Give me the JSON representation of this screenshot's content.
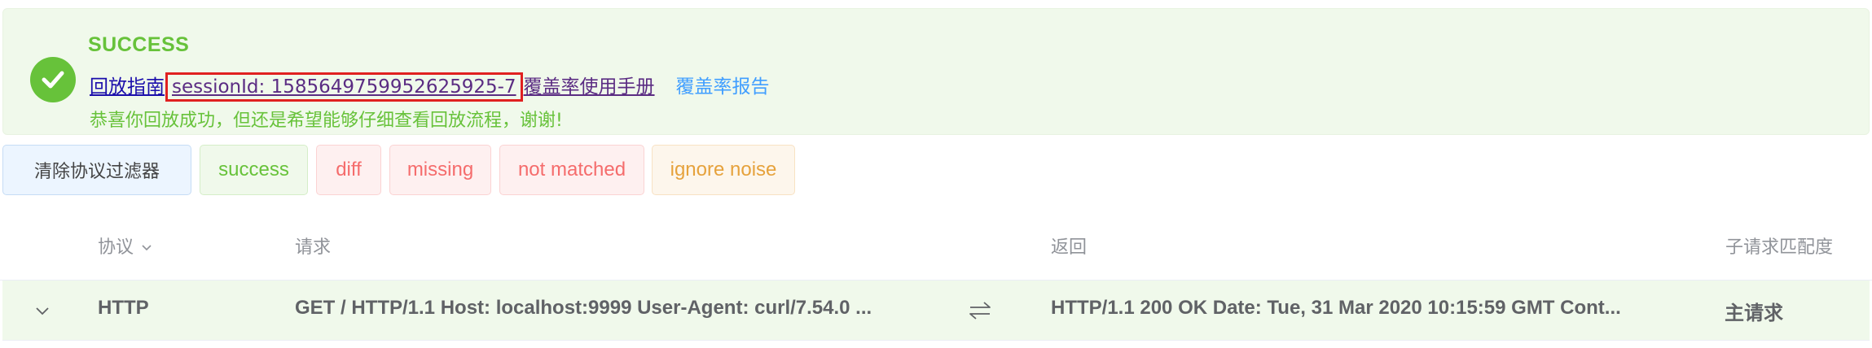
{
  "banner": {
    "title": "SUCCESS",
    "guide_link": "回放指南",
    "session_link": "sessionId: 1585649759952625925-7",
    "manual_link": "覆盖率使用手册",
    "report_link": "覆盖率报告",
    "message": "恭喜你回放成功，但还是希望能够仔细查看回放流程，谢谢!",
    "icon": "check-circle-icon",
    "accent": "#67c23a"
  },
  "filters": {
    "clear": "清除协议过滤器",
    "success": "success",
    "diff": "diff",
    "missing": "missing",
    "not_matched": "not matched",
    "ignore_noise": "ignore noise"
  },
  "table": {
    "headers": {
      "protocol": "协议",
      "request": "请求",
      "response": "返回",
      "match": "子请求匹配度"
    },
    "rows": [
      {
        "protocol": "HTTP",
        "request": "GET / HTTP/1.1 Host: localhost:9999 User-Agent: curl/7.54.0 ...",
        "response": "HTTP/1.1 200 OK Date: Tue, 31 Mar 2020 10:15:59 GMT Cont...",
        "match": "主请求"
      }
    ]
  },
  "colors": {
    "success": "#67c23a",
    "danger": "#f56c6c",
    "warning": "#e6a23c",
    "primary": "#409eff",
    "highlight_box": "#e02020"
  }
}
